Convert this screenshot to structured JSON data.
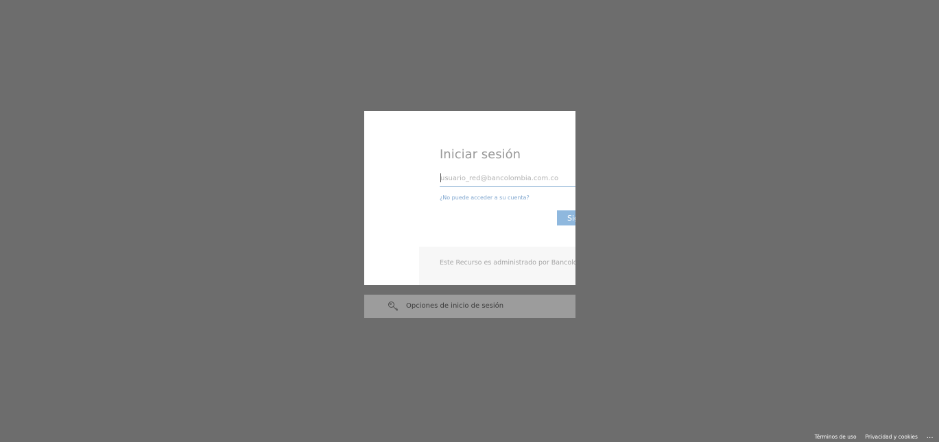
{
  "signin": {
    "title": "Iniciar sesión",
    "email_placeholder": "usuario_red@bancolombia.com.co",
    "email_value": "",
    "help_link": "¿No puede acceder a su cuenta?",
    "next_button": "Siguiente",
    "admin_notice": "Este Recurso es administrado por Bancolombia"
  },
  "options_bar": {
    "label": "Opciones de inicio de sesión",
    "icon": "key-icon"
  },
  "footer": {
    "terms": "Términos de uso",
    "privacy": "Privacidad y cookies",
    "more": "..."
  },
  "colors": {
    "backdrop": "#6d6d6d",
    "card": "#ffffff",
    "accent": "#8fb8de",
    "link": "#7fa6cf",
    "options_bar": "#9c9c9c"
  }
}
